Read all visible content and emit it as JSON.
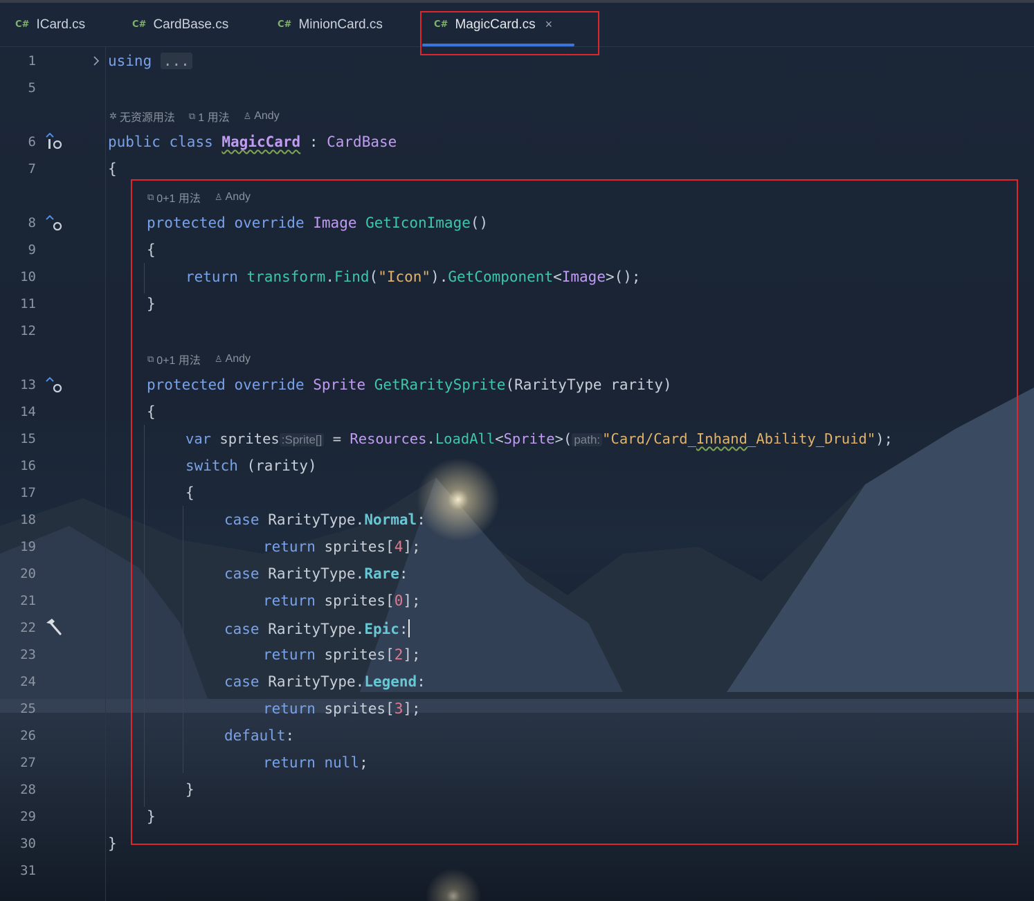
{
  "tabs": [
    {
      "lang": "C#",
      "label": "ICard.cs"
    },
    {
      "lang": "C#",
      "label": "CardBase.cs"
    },
    {
      "lang": "C#",
      "label": "MinionCard.cs"
    },
    {
      "lang": "C#",
      "label": "MagicCard.cs",
      "close": "×"
    }
  ],
  "line_numbers": [
    "1",
    "5",
    "6",
    "7",
    "8",
    "9",
    "10",
    "11",
    "12",
    "13",
    "14",
    "15",
    "16",
    "17",
    "18",
    "19",
    "20",
    "21",
    "22",
    "23",
    "24",
    "25",
    "26",
    "27",
    "28",
    "29",
    "30",
    "31"
  ],
  "hints": {
    "class_hint": {
      "assets": "无资源用法",
      "usages": "1 用法",
      "author": "Andy"
    },
    "method1_hint": {
      "usages": "0+1 用法",
      "author": "Andy"
    },
    "method2_hint": {
      "usages": "0+1 用法",
      "author": "Andy"
    }
  },
  "code": {
    "l1_kw": "using",
    "l1_fold": "...",
    "l6_public": "public",
    "l6_class": "class",
    "l6_name": "MagicCard",
    "l6_colon": " : ",
    "l6_base": "CardBase",
    "brace_open": "{",
    "brace_close": "}",
    "l8_protected": "protected",
    "l8_override": "override",
    "l8_type": "Image",
    "l8_fn": "GetIconImage",
    "parens": "()",
    "l10_return": "return",
    "l10_transform": "transform",
    "dot": ".",
    "l10_find": "Find",
    "l10_icon": "\"Icon\"",
    "l10_getcomp": "GetComponent",
    "l13_type": "Sprite",
    "l13_fn": "GetRaritySprite",
    "l13_ptype": "RarityType",
    "l13_pname": "rarity",
    "l15_var": "var",
    "l15_name": "sprites",
    "l15_hint_type": ":Sprite[]",
    "l15_eq": " = ",
    "l15_resources": "Resources",
    "l15_loadall": "LoadAll",
    "l15_path_hint": "path:",
    "l15_str1": "\"Card/Card_",
    "l15_str2": "Inhand",
    "l15_str3": "_Ability_Druid\"",
    "l16_switch": "switch",
    "l16_arg": "(rarity)",
    "case": "case",
    "enum_type": "RarityType",
    "normal": "Normal",
    "rare": "Rare",
    "epic": "Epic",
    "legend": "Legend",
    "return": "return",
    "sprites": "sprites",
    "idx4": "4",
    "idx0": "0",
    "idx2": "2",
    "idx3": "3",
    "default": "default",
    "null": "null"
  },
  "colors": {
    "accent": "#3a74dd",
    "highlight_box": "#e0262d"
  }
}
